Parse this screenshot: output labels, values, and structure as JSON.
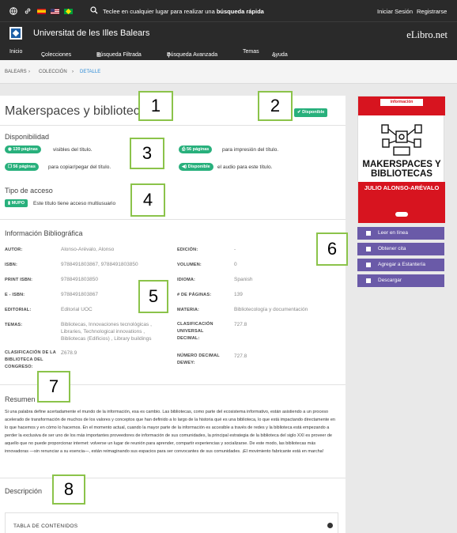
{
  "topbar": {
    "search_prefix": "Teclee en cualquier lugar para realizar una ",
    "search_bold": "búsqueda rápida",
    "login": "Iniciar Sesión",
    "register": "Registrarse",
    "university": "Universitat de les Illes Balears",
    "brand": "eLibro.net"
  },
  "nav": {
    "inicio": "Inicio",
    "colecciones": "Colecciones",
    "busqueda_filtrada": "Búsqueda Filtrada",
    "busqueda_avanzada": "Búsqueda Avanzada",
    "temas": "Temas",
    "ayuda": "Ayuda"
  },
  "breadcrumb": {
    "b1": "BALEARS",
    "b2": "COLECCIÓN",
    "b3": "DETALLE"
  },
  "book": {
    "title": "Makerspaces y bibliotecas",
    "status": "Disponible"
  },
  "disponibilidad": {
    "heading": "Disponibilidad",
    "view_pages": "139 páginas",
    "view_text": "visibles del título.",
    "print_pages": "56 páginas",
    "print_text": "para impresión del título.",
    "copy_pages": "56 páginas",
    "copy_text": "para copiar/pegar del título.",
    "audio_badge": "Disponible",
    "audio_text": "el audio para este título."
  },
  "acceso": {
    "heading": "Tipo de acceso",
    "badge": "MUPO",
    "text": "Este título tiene acceso multiusuario"
  },
  "bib": {
    "heading": "Información Bibliográfica",
    "autor_l": "AUTOR:",
    "autor_v": "Alonso-Arévalo, Alonso",
    "isbn_l": "ISBN:",
    "isbn_v": "9788491803867, 9788491803850",
    "pisbn_l": "PRINT ISBN:",
    "pisbn_v": "9788491803850",
    "eisbn_l": "E - ISBN:",
    "eisbn_v": "9788491803867",
    "editorial_l": "EDITORIAL:",
    "editorial_v": "Editorial UOC",
    "temas_l": "TEMAS:",
    "temas_v": "Bibliotecas, Innovaciones tecnológicas , Libraries, Technological innovations , Bibliotecas (Edificios) , Library buildings",
    "clasif_l": "CLASIFICACIÓN DE LA BIBLIOTECA DEL CONGRESO:",
    "clasif_v": "Z678.9",
    "edicion_l": "EDICIÓN:",
    "edicion_v": "-",
    "volumen_l": "VOLUMEN:",
    "volumen_v": "0",
    "idioma_l": "IDIOMA:",
    "idioma_v": "Spanish",
    "paginas_l": "# DE PÁGINAS:",
    "paginas_v": "139",
    "materia_l": "MATERIA:",
    "materia_v": "Bibliotecología y documentación",
    "cud_l": "CLASIFICACIÓN UNIVERSAL DECIMAL:",
    "cud_v": "727.8",
    "dewey_l": "NÚMERO DECIMAL DEWEY:",
    "dewey_v": "727.8"
  },
  "resumen": {
    "heading": "Resumen",
    "text": "Si una palabra define acertadamente el mundo de la información, esa es cambio. Las bibliotecas, como parte del ecosistema informativo, están asistiendo a un proceso acelerado de transformación de muchos de los valores y conceptos que han definido a lo largo de la historia qué es una biblioteca, lo que está impactando directamente en lo que hacemos y en cómo lo hacemos. En el momento actual, cuando la mayor parte de la información es accesible a través de redes y la biblioteca está empezando a perder la exclusiva de ser uno de los más importantes proveedores de información de sus comunidades, la principal estrategia de la biblioteca del siglo XXI es proveer de aquello que no puede proporcionar internet: volverse un lugar de reunión para aprender, compartir experiencias y socializarse. De este modo, las bibliotecas más innovadoras —sin renunciar a su esencia—, están reimaginando sus espacios para ser convocantes de sus comunidades. ¡El movimiento fabricante está en marcha!"
  },
  "descripcion": {
    "heading": "Descripción",
    "toc": "TABLA DE CONTENIDOS"
  },
  "cover": {
    "top_badge": "información",
    "title": "MAKERSPACES Y BIBLIOTECAS",
    "author": "JULIO ALONSO-ARÉVALO"
  },
  "actions": {
    "leer": "Leer en línea",
    "cita": "Obtener cita",
    "estanteria": "Agregar a Estantería",
    "descargar": "Descargar"
  },
  "callouts": [
    "1",
    "2",
    "3",
    "4",
    "5",
    "6",
    "7",
    "8"
  ],
  "colors": {
    "accent_green": "#28b07c",
    "action_purple": "#6a5aa8",
    "callout_green": "#8bc34a",
    "header_dark": "#2a2a2a",
    "link_blue": "#2a8ad6"
  }
}
